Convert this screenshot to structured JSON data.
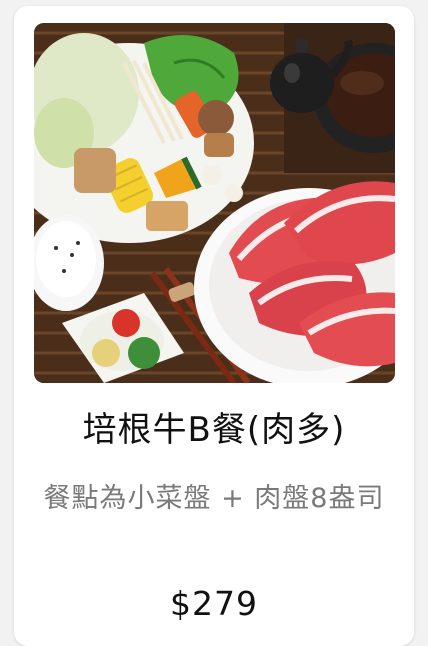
{
  "item": {
    "name": "培根牛B餐(肉多)",
    "description": "餐點為小菜盤 + 肉盤8盎司",
    "price": "$279",
    "image_alt": "hot-pot-set-photo"
  }
}
